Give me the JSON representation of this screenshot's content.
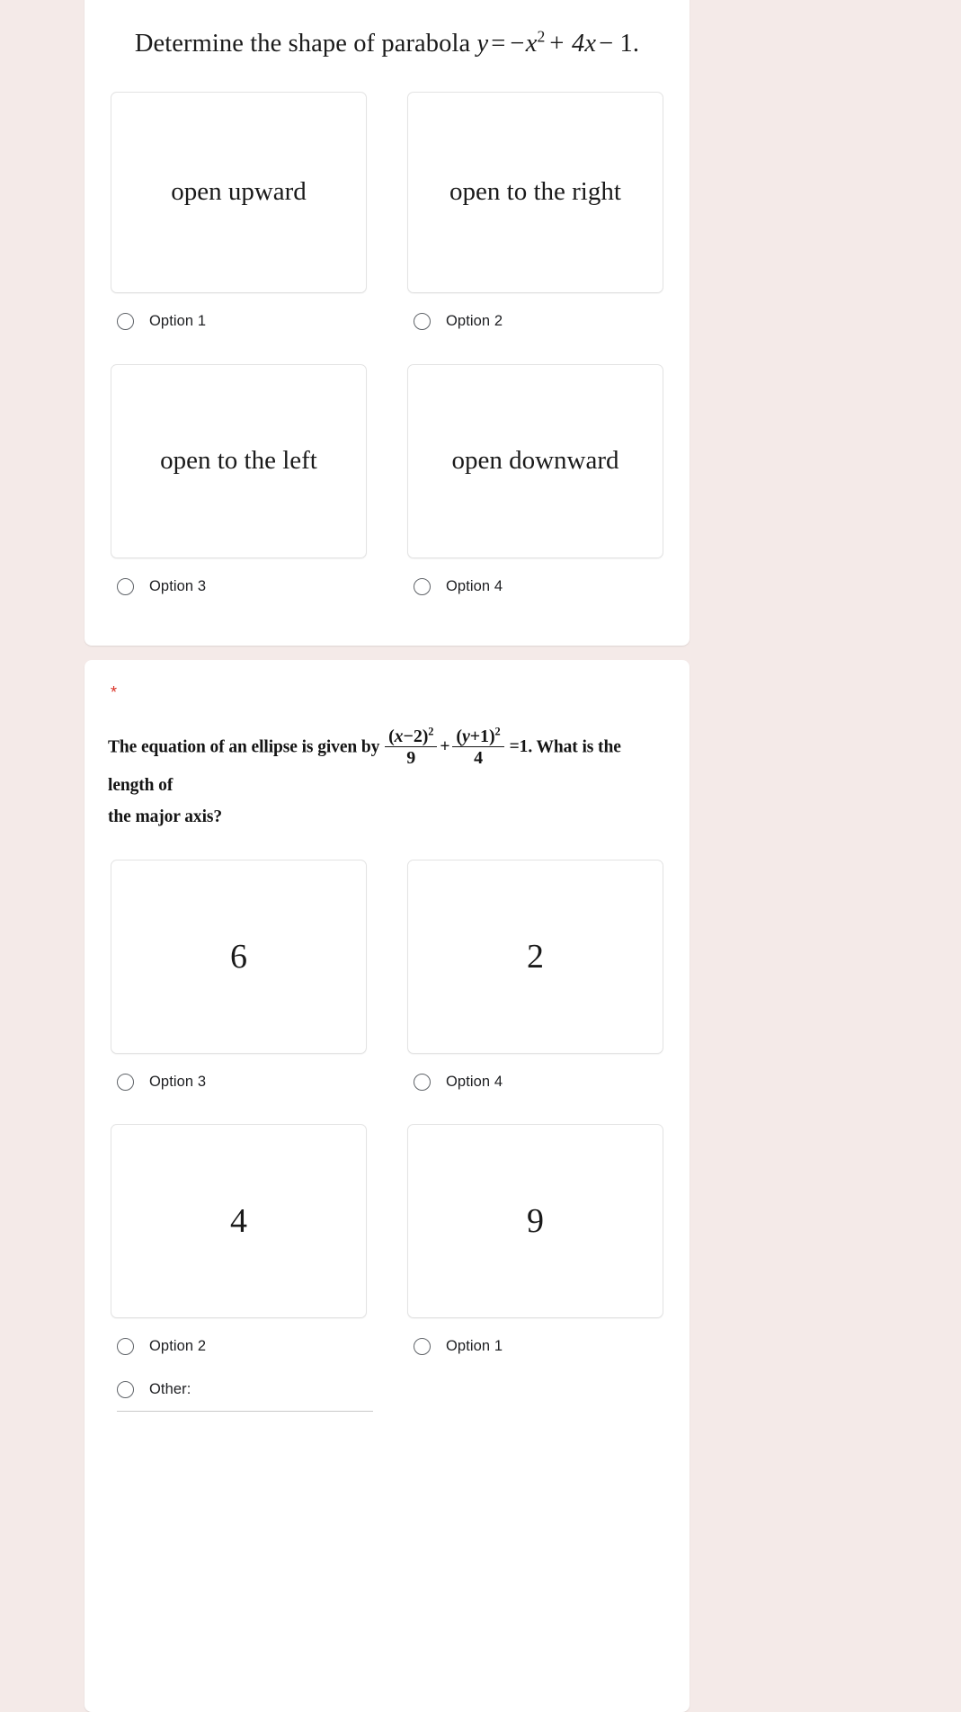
{
  "page": {
    "background_color": "#f4eae8",
    "card_background": "#ffffff",
    "required_marker": "*",
    "required_marker_color": "#d93025"
  },
  "question1": {
    "title_prefix": "Determine the shape of parabola ",
    "equation": {
      "lhs": "y",
      "eq": "=",
      "term1": "−x",
      "term1_exp": "2",
      "term2": "+ 4x",
      "term3": "− 1",
      "period": "."
    },
    "options": [
      {
        "card_text": "open upward",
        "radio_label": "Option 1"
      },
      {
        "card_text": "open to the right",
        "radio_label": "Option 2"
      },
      {
        "card_text": "open to the left",
        "radio_label": "Option 3"
      },
      {
        "card_text": "open downward",
        "radio_label": "Option 4"
      }
    ]
  },
  "question2": {
    "text_part1": "The equation of an ellipse is given by ",
    "frac1_num_open": "(",
    "frac1_num_var": "x",
    "frac1_num_rest": "−2",
    "frac1_num_close": ")",
    "frac1_num_exp": "2",
    "frac1_den": "9",
    "plus": "+",
    "frac2_num_open": "(",
    "frac2_num_var": "y",
    "frac2_num_rest": "+1",
    "frac2_num_close": ")",
    "frac2_num_exp": "2",
    "frac2_den": "4",
    "equals_one": "=1",
    "text_part2": ". What is the length of",
    "text_part3": "the major axis?",
    "options": [
      {
        "card_text": "6",
        "radio_label": "Option 3"
      },
      {
        "card_text": "2",
        "radio_label": "Option 4"
      },
      {
        "card_text": "4",
        "radio_label": "Option 2"
      },
      {
        "card_text": "9",
        "radio_label": "Option 1"
      }
    ],
    "other_label": "Other:",
    "other_value": ""
  }
}
